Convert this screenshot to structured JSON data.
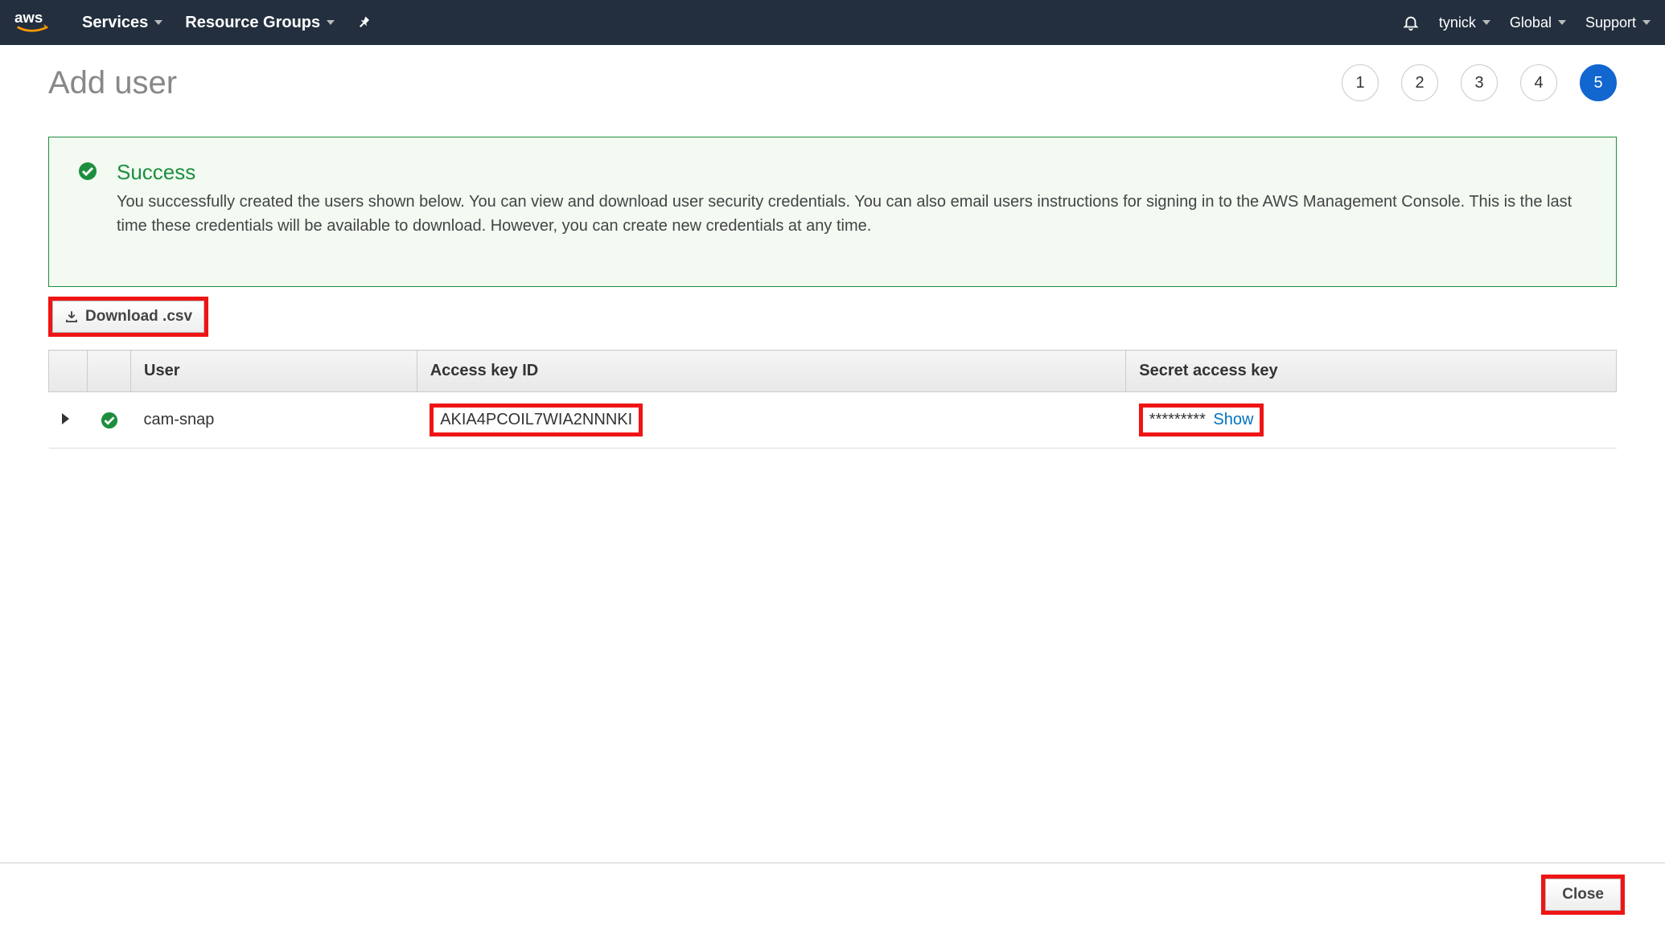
{
  "topnav": {
    "services": "Services",
    "resource_groups": "Resource Groups",
    "user": "tynick",
    "region": "Global",
    "support": "Support"
  },
  "page": {
    "title": "Add user",
    "steps": [
      "1",
      "2",
      "3",
      "4",
      "5"
    ],
    "active_step_index": 4
  },
  "success": {
    "title": "Success",
    "message": "You successfully created the users shown below. You can view and download user security credentials. You can also email users instructions for signing in to the AWS Management Console. This is the last time these credentials will be available to download. However, you can create new credentials at any time."
  },
  "download_button": "Download .csv",
  "table": {
    "headers": {
      "user": "User",
      "access_key_id": "Access key ID",
      "secret_access_key": "Secret access key"
    },
    "rows": [
      {
        "user": "cam-snap",
        "access_key_id": "AKIA4PCOIL7WIA2NNNKI",
        "secret_masked": "*********",
        "show_label": "Show"
      }
    ]
  },
  "footer": {
    "close": "Close"
  }
}
